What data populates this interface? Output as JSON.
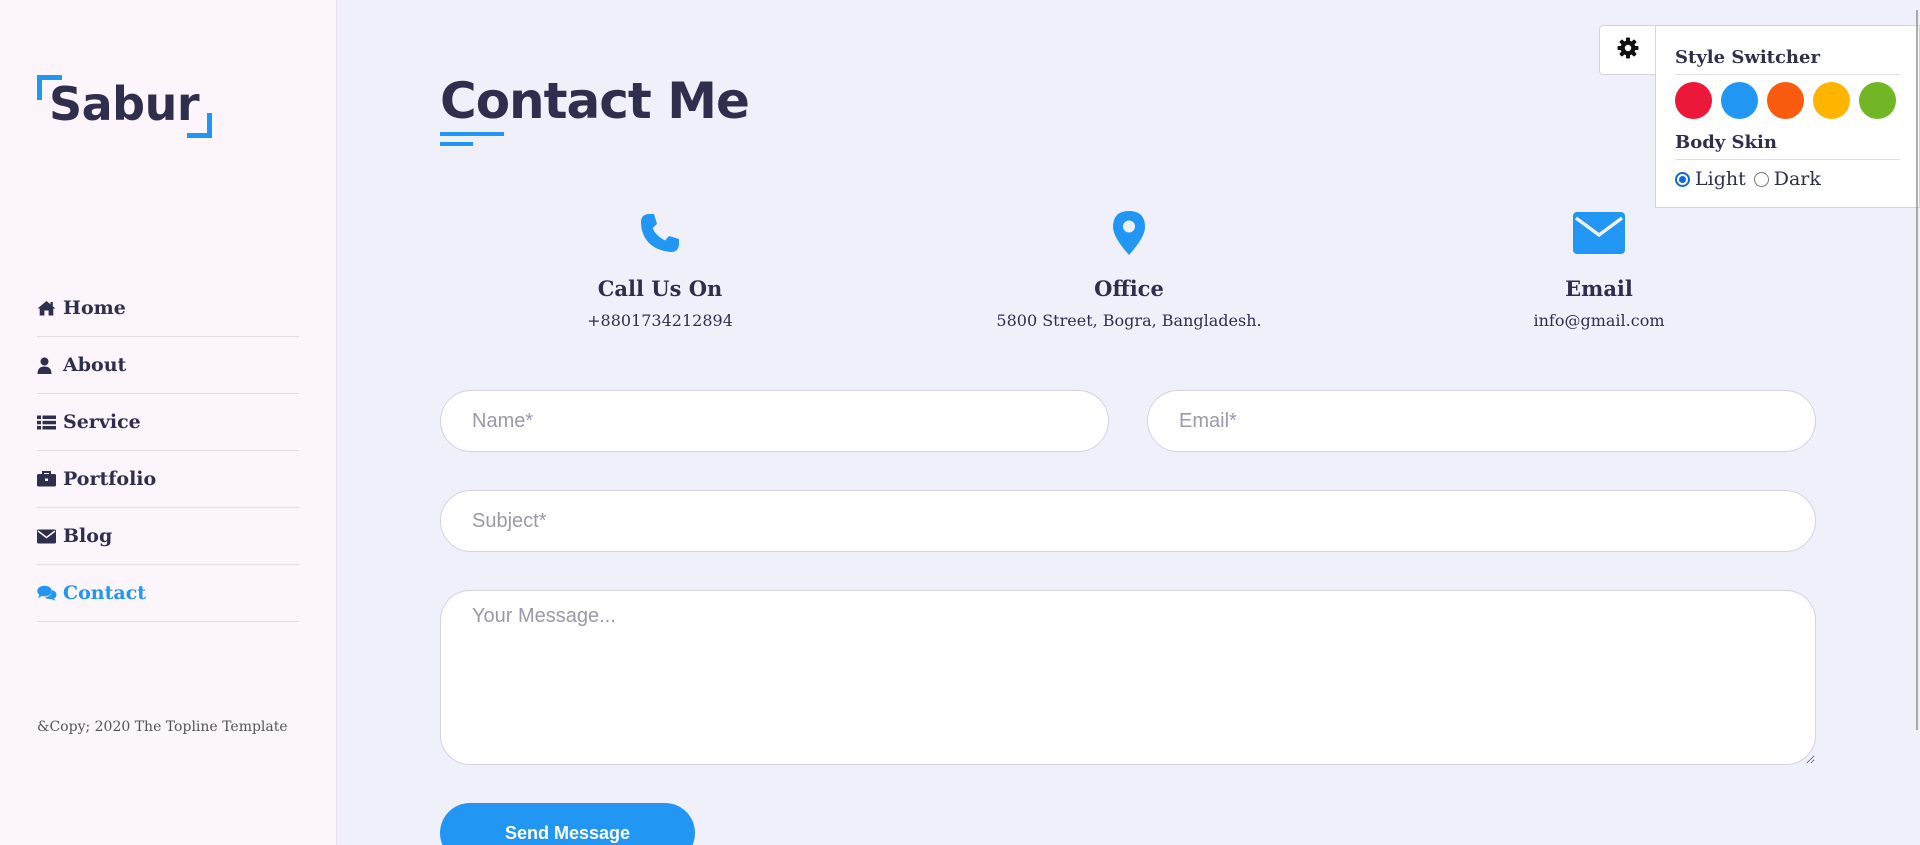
{
  "logo": {
    "text": "Sabur"
  },
  "nav": {
    "items": [
      {
        "label": "Home",
        "icon": "home-icon",
        "active": false
      },
      {
        "label": "About",
        "icon": "user-icon",
        "active": false
      },
      {
        "label": "Service",
        "icon": "list-icon",
        "active": false
      },
      {
        "label": "Portfolio",
        "icon": "briefcase-icon",
        "active": false
      },
      {
        "label": "Blog",
        "icon": "envelope-icon",
        "active": false
      },
      {
        "label": "Contact",
        "icon": "comments-icon",
        "active": true
      }
    ]
  },
  "footer": {
    "copyright": "&Copy; 2020 The Topline Template"
  },
  "page": {
    "title": "Contact Me"
  },
  "info": [
    {
      "title": "Call Us On",
      "text": "+8801734212894",
      "icon": "phone-icon"
    },
    {
      "title": "Office",
      "text": "5800 Street, Bogra, Bangladesh.",
      "icon": "map-marker-icon"
    },
    {
      "title": "Email",
      "text": "info@gmail.com",
      "icon": "envelope-icon"
    }
  ],
  "form": {
    "name_placeholder": "Name*",
    "email_placeholder": "Email*",
    "subject_placeholder": "Subject*",
    "message_placeholder": "Your Message...",
    "submit_label": "Send Message"
  },
  "style_switcher": {
    "title": "Style Switcher",
    "colors": [
      "#ec1839",
      "#2196f3",
      "#fa5b0f",
      "#ffb400",
      "#72b626"
    ],
    "skin_title": "Body Skin",
    "skin_options": [
      "Light",
      "Dark"
    ],
    "skin_selected": "Light"
  },
  "theme": {
    "accent": "#2196f3",
    "text": "#302e4d",
    "background": "#f0f0fb",
    "sidebar": "#fcf5fb"
  }
}
